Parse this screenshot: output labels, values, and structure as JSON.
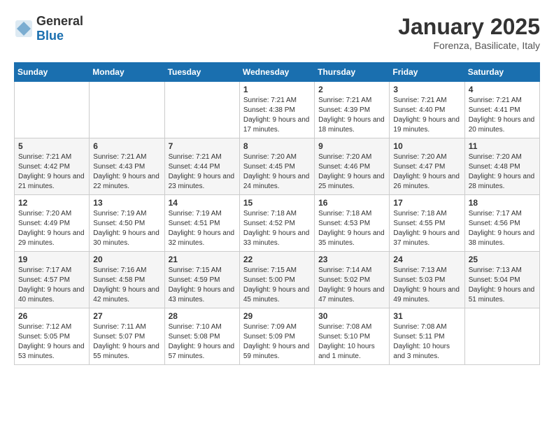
{
  "header": {
    "logo_general": "General",
    "logo_blue": "Blue",
    "month": "January 2025",
    "location": "Forenza, Basilicate, Italy"
  },
  "days_of_week": [
    "Sunday",
    "Monday",
    "Tuesday",
    "Wednesday",
    "Thursday",
    "Friday",
    "Saturday"
  ],
  "weeks": [
    [
      {
        "day": "",
        "content": ""
      },
      {
        "day": "",
        "content": ""
      },
      {
        "day": "",
        "content": ""
      },
      {
        "day": "1",
        "content": "Sunrise: 7:21 AM\nSunset: 4:38 PM\nDaylight: 9 hours and 17 minutes."
      },
      {
        "day": "2",
        "content": "Sunrise: 7:21 AM\nSunset: 4:39 PM\nDaylight: 9 hours and 18 minutes."
      },
      {
        "day": "3",
        "content": "Sunrise: 7:21 AM\nSunset: 4:40 PM\nDaylight: 9 hours and 19 minutes."
      },
      {
        "day": "4",
        "content": "Sunrise: 7:21 AM\nSunset: 4:41 PM\nDaylight: 9 hours and 20 minutes."
      }
    ],
    [
      {
        "day": "5",
        "content": "Sunrise: 7:21 AM\nSunset: 4:42 PM\nDaylight: 9 hours and 21 minutes."
      },
      {
        "day": "6",
        "content": "Sunrise: 7:21 AM\nSunset: 4:43 PM\nDaylight: 9 hours and 22 minutes."
      },
      {
        "day": "7",
        "content": "Sunrise: 7:21 AM\nSunset: 4:44 PM\nDaylight: 9 hours and 23 minutes."
      },
      {
        "day": "8",
        "content": "Sunrise: 7:20 AM\nSunset: 4:45 PM\nDaylight: 9 hours and 24 minutes."
      },
      {
        "day": "9",
        "content": "Sunrise: 7:20 AM\nSunset: 4:46 PM\nDaylight: 9 hours and 25 minutes."
      },
      {
        "day": "10",
        "content": "Sunrise: 7:20 AM\nSunset: 4:47 PM\nDaylight: 9 hours and 26 minutes."
      },
      {
        "day": "11",
        "content": "Sunrise: 7:20 AM\nSunset: 4:48 PM\nDaylight: 9 hours and 28 minutes."
      }
    ],
    [
      {
        "day": "12",
        "content": "Sunrise: 7:20 AM\nSunset: 4:49 PM\nDaylight: 9 hours and 29 minutes."
      },
      {
        "day": "13",
        "content": "Sunrise: 7:19 AM\nSunset: 4:50 PM\nDaylight: 9 hours and 30 minutes."
      },
      {
        "day": "14",
        "content": "Sunrise: 7:19 AM\nSunset: 4:51 PM\nDaylight: 9 hours and 32 minutes."
      },
      {
        "day": "15",
        "content": "Sunrise: 7:18 AM\nSunset: 4:52 PM\nDaylight: 9 hours and 33 minutes."
      },
      {
        "day": "16",
        "content": "Sunrise: 7:18 AM\nSunset: 4:53 PM\nDaylight: 9 hours and 35 minutes."
      },
      {
        "day": "17",
        "content": "Sunrise: 7:18 AM\nSunset: 4:55 PM\nDaylight: 9 hours and 37 minutes."
      },
      {
        "day": "18",
        "content": "Sunrise: 7:17 AM\nSunset: 4:56 PM\nDaylight: 9 hours and 38 minutes."
      }
    ],
    [
      {
        "day": "19",
        "content": "Sunrise: 7:17 AM\nSunset: 4:57 PM\nDaylight: 9 hours and 40 minutes."
      },
      {
        "day": "20",
        "content": "Sunrise: 7:16 AM\nSunset: 4:58 PM\nDaylight: 9 hours and 42 minutes."
      },
      {
        "day": "21",
        "content": "Sunrise: 7:15 AM\nSunset: 4:59 PM\nDaylight: 9 hours and 43 minutes."
      },
      {
        "day": "22",
        "content": "Sunrise: 7:15 AM\nSunset: 5:00 PM\nDaylight: 9 hours and 45 minutes."
      },
      {
        "day": "23",
        "content": "Sunrise: 7:14 AM\nSunset: 5:02 PM\nDaylight: 9 hours and 47 minutes."
      },
      {
        "day": "24",
        "content": "Sunrise: 7:13 AM\nSunset: 5:03 PM\nDaylight: 9 hours and 49 minutes."
      },
      {
        "day": "25",
        "content": "Sunrise: 7:13 AM\nSunset: 5:04 PM\nDaylight: 9 hours and 51 minutes."
      }
    ],
    [
      {
        "day": "26",
        "content": "Sunrise: 7:12 AM\nSunset: 5:05 PM\nDaylight: 9 hours and 53 minutes."
      },
      {
        "day": "27",
        "content": "Sunrise: 7:11 AM\nSunset: 5:07 PM\nDaylight: 9 hours and 55 minutes."
      },
      {
        "day": "28",
        "content": "Sunrise: 7:10 AM\nSunset: 5:08 PM\nDaylight: 9 hours and 57 minutes."
      },
      {
        "day": "29",
        "content": "Sunrise: 7:09 AM\nSunset: 5:09 PM\nDaylight: 9 hours and 59 minutes."
      },
      {
        "day": "30",
        "content": "Sunrise: 7:08 AM\nSunset: 5:10 PM\nDaylight: 10 hours and 1 minute."
      },
      {
        "day": "31",
        "content": "Sunrise: 7:08 AM\nSunset: 5:11 PM\nDaylight: 10 hours and 3 minutes."
      },
      {
        "day": "",
        "content": ""
      }
    ]
  ]
}
